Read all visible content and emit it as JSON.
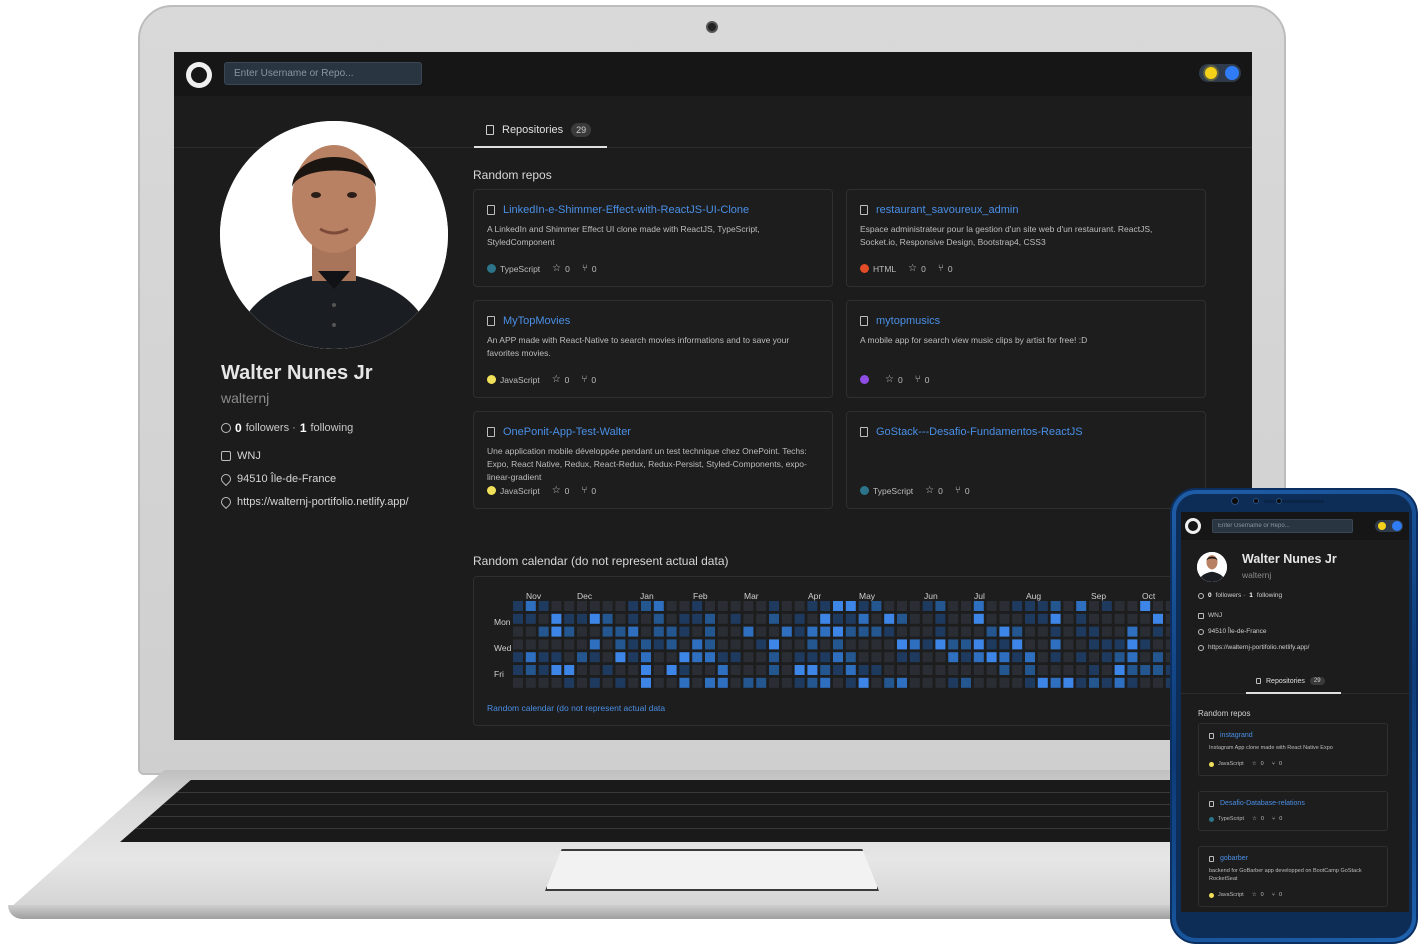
{
  "colors": {
    "accent": "#4a8fe6",
    "typescript": "#2b7489",
    "html": "#e34c26",
    "javascript": "#f1e05a",
    "purple": "#8e4ee6",
    "cal_levels": [
      "#2a2e34",
      "#1e3a5f",
      "#245690",
      "#2f6fc0",
      "#3d86e8"
    ]
  },
  "header": {
    "search_placeholder": "Enter Username or Repo..."
  },
  "profile": {
    "name": "Walter Nunes Jr",
    "login": "walternj",
    "followers_count": "0",
    "followers_label": "followers ·",
    "following_count": "1",
    "following_label": "following",
    "company": "WNJ",
    "location": "94510 Île-de-France",
    "website": "https://walternj-portifolio.netlify.app/"
  },
  "tabs": {
    "repositories_label": "Repositories",
    "repositories_count": "29"
  },
  "random_repos": {
    "title": "Random repos",
    "cards": [
      {
        "name": "LinkedIn-e-Shimmer-Effect-with-ReactJS-UI-Clone",
        "description": "A LinkedIn and Shimmer Effect UI clone made with ReactJS, TypeScript, StyledComponent",
        "language": "TypeScript",
        "lang_color": "#2b7489",
        "stars": "0",
        "forks": "0"
      },
      {
        "name": "restaurant_savoureux_admin",
        "description": "Espace administrateur pour la gestion d'un site web d'un restaurant. ReactJS, Socket.io, Responsive Design, Bootstrap4, CSS3",
        "language": "HTML",
        "lang_color": "#e34c26",
        "stars": "0",
        "forks": "0"
      },
      {
        "name": "MyTopMovies",
        "description": "An APP made with React-Native to search movies informations and to save your favorites movies.",
        "language": "JavaScript",
        "lang_color": "#f1e05a",
        "stars": "0",
        "forks": "0"
      },
      {
        "name": "mytopmusics",
        "description": "A mobile app for search view music clips by artist for free! :D",
        "language": "",
        "lang_color": "#8e4ee6",
        "stars": "0",
        "forks": "0"
      },
      {
        "name": "OnePonit-App-Test-Walter",
        "description": "Une application mobile développée pendant un test technique chez OnePoint. Techs: Expo, React Native, Redux, React-Redux, Redux-Persist, Styled-Components, expo-linear-gradient",
        "language": "JavaScript",
        "lang_color": "#f1e05a",
        "stars": "0",
        "forks": "0"
      },
      {
        "name": "GoStack---Desafio-Fundamentos-ReactJS",
        "description": "",
        "language": "TypeScript",
        "lang_color": "#2b7489",
        "stars": "0",
        "forks": "0"
      }
    ]
  },
  "calendar": {
    "title": "Random calendar (do not represent actual data)",
    "months": [
      "Nov",
      "Dec",
      "Jan",
      "Feb",
      "Mar",
      "Apr",
      "May",
      "Jun",
      "Jul",
      "Aug",
      "Sep",
      "Oct"
    ],
    "day_labels": [
      "Mon",
      "Wed",
      "Fri"
    ],
    "note": "Random calendar (do not represent actual data"
  },
  "mobile": {
    "search_placeholder": "Enter Username or Repo...",
    "name": "Walter Nunes Jr",
    "login": "walternj",
    "followers_count": "0",
    "followers_label": "followers ·",
    "following_count": "1",
    "following_label": "following",
    "company": "WNJ",
    "location": "94510 Île-de-France",
    "website": "https://walternj-portifolio.netlify.app/",
    "tab_label": "Repositories",
    "tab_count": "29",
    "section_title": "Random repos",
    "cards": [
      {
        "name": "instagrand",
        "description": "Instagram App clone made with React Native Expo",
        "language": "JavaScript",
        "lang_color": "#f1e05a",
        "stars": "0",
        "forks": "0"
      },
      {
        "name": "Desafio-Database-relations",
        "description": "",
        "language": "TypeScript",
        "lang_color": "#2b7489",
        "stars": "0",
        "forks": "0"
      },
      {
        "name": "gobarber",
        "description": "backend for GoBarber app developped on BootCamp GoStack RocketSeat",
        "language": "JavaScript",
        "lang_color": "#f1e05a",
        "stars": "0",
        "forks": "0"
      }
    ]
  }
}
